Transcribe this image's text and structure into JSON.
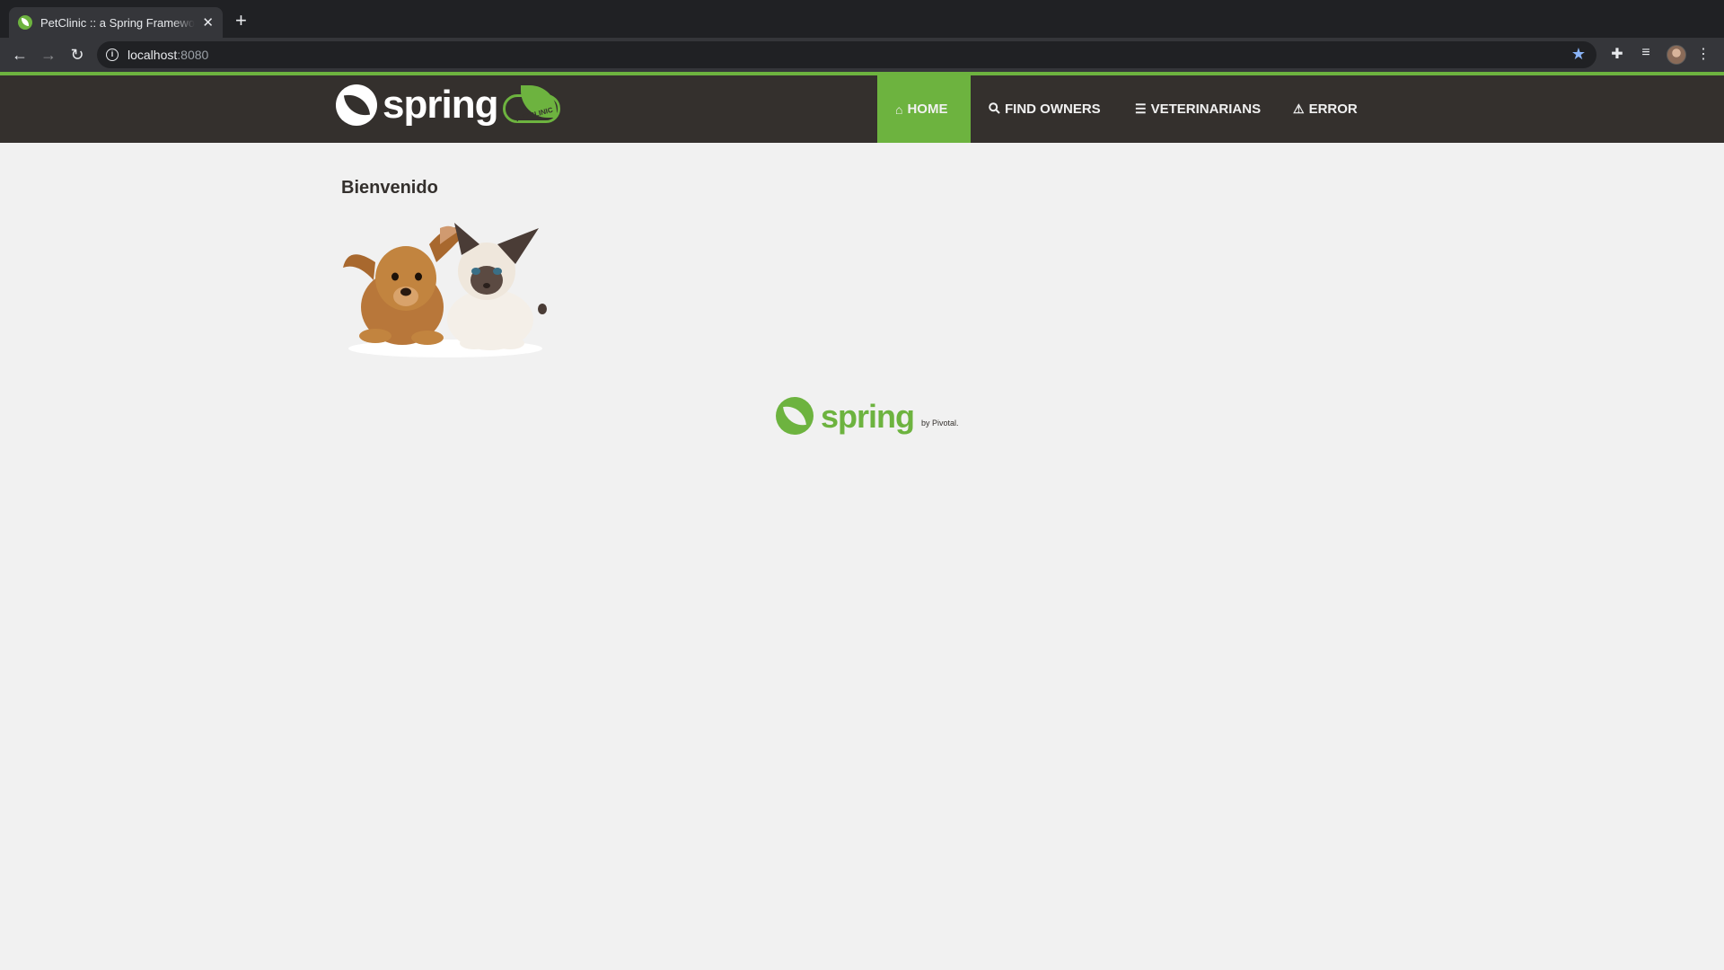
{
  "browser": {
    "tab": {
      "title": "PetClinic :: a Spring Framework demonstration",
      "close": "✕"
    },
    "new_tab": "+",
    "url": {
      "host": "localhost",
      "port": ":8080"
    },
    "icons": {
      "back": "back-arrow-icon",
      "forward": "forward-arrow-icon",
      "reload": "reload-icon",
      "info": "info-icon",
      "bookmark": "star-icon",
      "extensions": "puzzle-icon",
      "media": "media-control-icon",
      "menu": "kebab-menu-icon"
    },
    "star_color": "#8ab4f8"
  },
  "header": {
    "brand": {
      "word": "spring",
      "badge": "PETCLINIC"
    },
    "nav": [
      {
        "label": "HOME",
        "icon": "home-icon",
        "glyph": "⌂",
        "active": true
      },
      {
        "label": "FIND OWNERS",
        "icon": "search-icon",
        "glyph": "🔍"
      },
      {
        "label": "VETERINARIANS",
        "icon": "list-icon",
        "glyph": "☰"
      },
      {
        "label": "ERROR",
        "icon": "warning-icon",
        "glyph": "⚠"
      }
    ],
    "colors": {
      "bar": "#34302d",
      "accent": "#6db33f"
    }
  },
  "main": {
    "heading": "Bienvenido",
    "image": "pets-image"
  },
  "footer": {
    "word": "spring",
    "by": "by Pivotal."
  }
}
